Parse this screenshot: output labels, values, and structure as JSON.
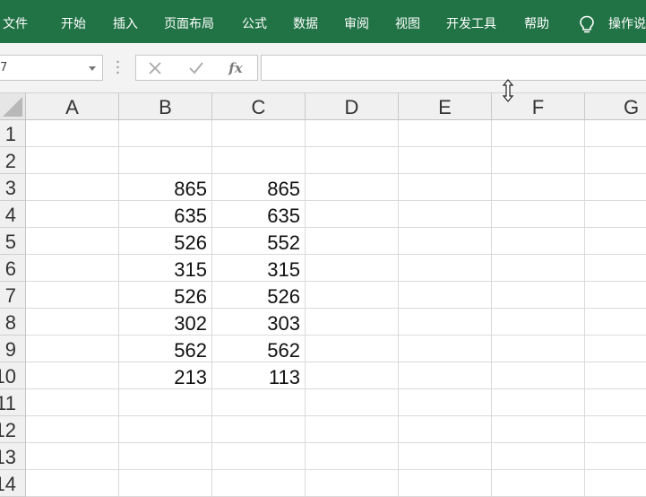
{
  "ribbon": {
    "tabs": [
      "文件",
      "开始",
      "插入",
      "页面布局",
      "公式",
      "数据",
      "审阅",
      "视图",
      "开发工具",
      "帮助"
    ],
    "tell_me": "操作说"
  },
  "formula_bar": {
    "name_box": "7",
    "fx_label": "fx",
    "formula": ""
  },
  "sheet": {
    "columns": [
      "A",
      "B",
      "C",
      "D",
      "E",
      "F",
      "G"
    ],
    "rows": [
      "1",
      "2",
      "3",
      "4",
      "5",
      "6",
      "7",
      "8",
      "9",
      "10",
      "11",
      "12",
      "13",
      "14"
    ],
    "data": [
      {
        "row": "3",
        "B": "865",
        "C": "865"
      },
      {
        "row": "4",
        "B": "635",
        "C": "635"
      },
      {
        "row": "5",
        "B": "526",
        "C": "552"
      },
      {
        "row": "6",
        "B": "315",
        "C": "315"
      },
      {
        "row": "7",
        "B": "526",
        "C": "526"
      },
      {
        "row": "8",
        "B": "302",
        "C": "303"
      },
      {
        "row": "9",
        "B": "562",
        "C": "562"
      },
      {
        "row": "10",
        "B": "213",
        "C": "113"
      }
    ]
  },
  "colors": {
    "ribbon": "#217346",
    "header_bg": "#f0f0f0",
    "grid_line": "#dadada"
  }
}
